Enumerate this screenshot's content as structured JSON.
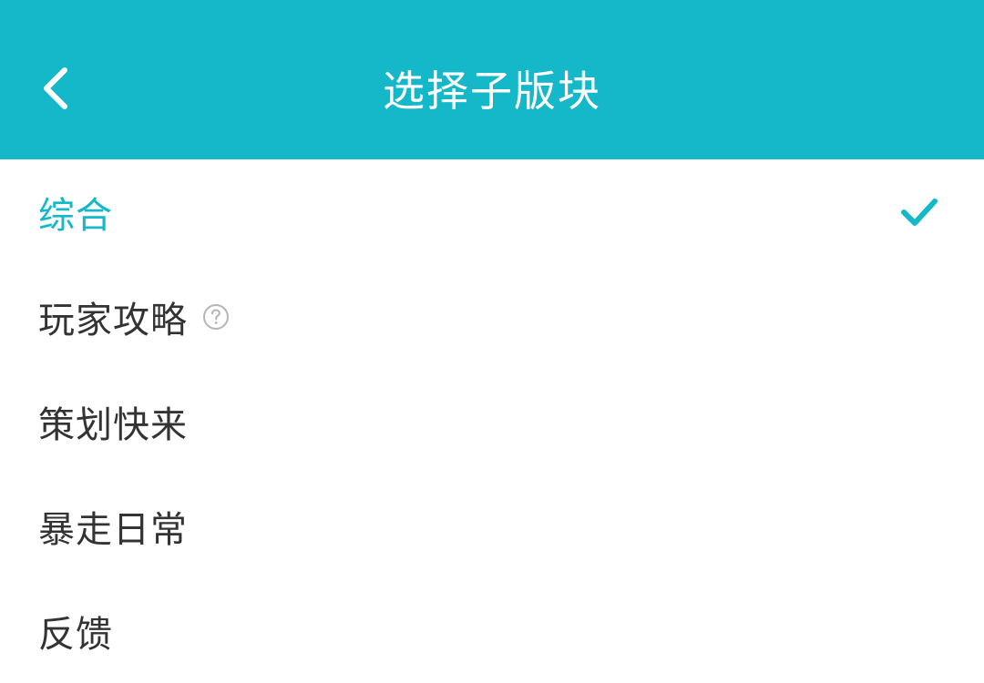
{
  "header": {
    "title": "选择子版块",
    "back_icon": "chevron-left-icon",
    "background_color": "#14b8c8"
  },
  "list": {
    "items": [
      {
        "label": "综合",
        "selected": true,
        "has_help": false
      },
      {
        "label": "玩家攻略",
        "selected": false,
        "has_help": true
      },
      {
        "label": "策划快来",
        "selected": false,
        "has_help": false
      },
      {
        "label": "暴走日常",
        "selected": false,
        "has_help": false
      },
      {
        "label": "反馈",
        "selected": false,
        "has_help": false
      }
    ],
    "selected_color": "#14b8c8",
    "text_color": "#333333",
    "check_icon": "checkmark-icon",
    "help_icon": "question-circle-icon"
  }
}
